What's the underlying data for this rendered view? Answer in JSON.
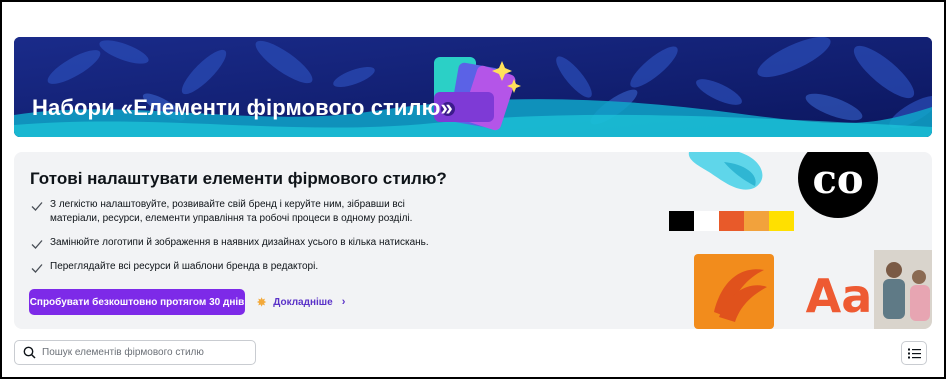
{
  "banner": {
    "title": "Набори «Елементи фірмового стилю»",
    "bg_color": "#0f1f73",
    "illustration": "brand-kit-swatches-icon"
  },
  "promo": {
    "title": "Готові налаштувати елементи фірмового стилю?",
    "features": [
      "З легкістю налаштовуйте, розвивайте свій бренд і керуйте ним, зібравши всі матеріали, ресурси, елементи управління та робочі процеси в одному розділі.",
      "Замінюйте логотипи й зображення в наявних дизайнах усього в кілька натискань.",
      "Переглядайте всі ресурси й шаблони бренда в редакторі."
    ],
    "cta_label": "Спробувати безкоштовно протягом 30 днів",
    "cta_color": "#7d2ae8",
    "more_label": "Докладніше",
    "art": {
      "palette": [
        "#000000",
        "#ffffff",
        "#e85a2a",
        "#f2a23c",
        "#ffe000"
      ],
      "logo_text": "co",
      "font_sample": "Aa"
    }
  },
  "search": {
    "placeholder": "Пошук елементів фірмового стилю",
    "value": ""
  },
  "toolbar": {
    "view_toggle_icon": "list-view-icon"
  }
}
